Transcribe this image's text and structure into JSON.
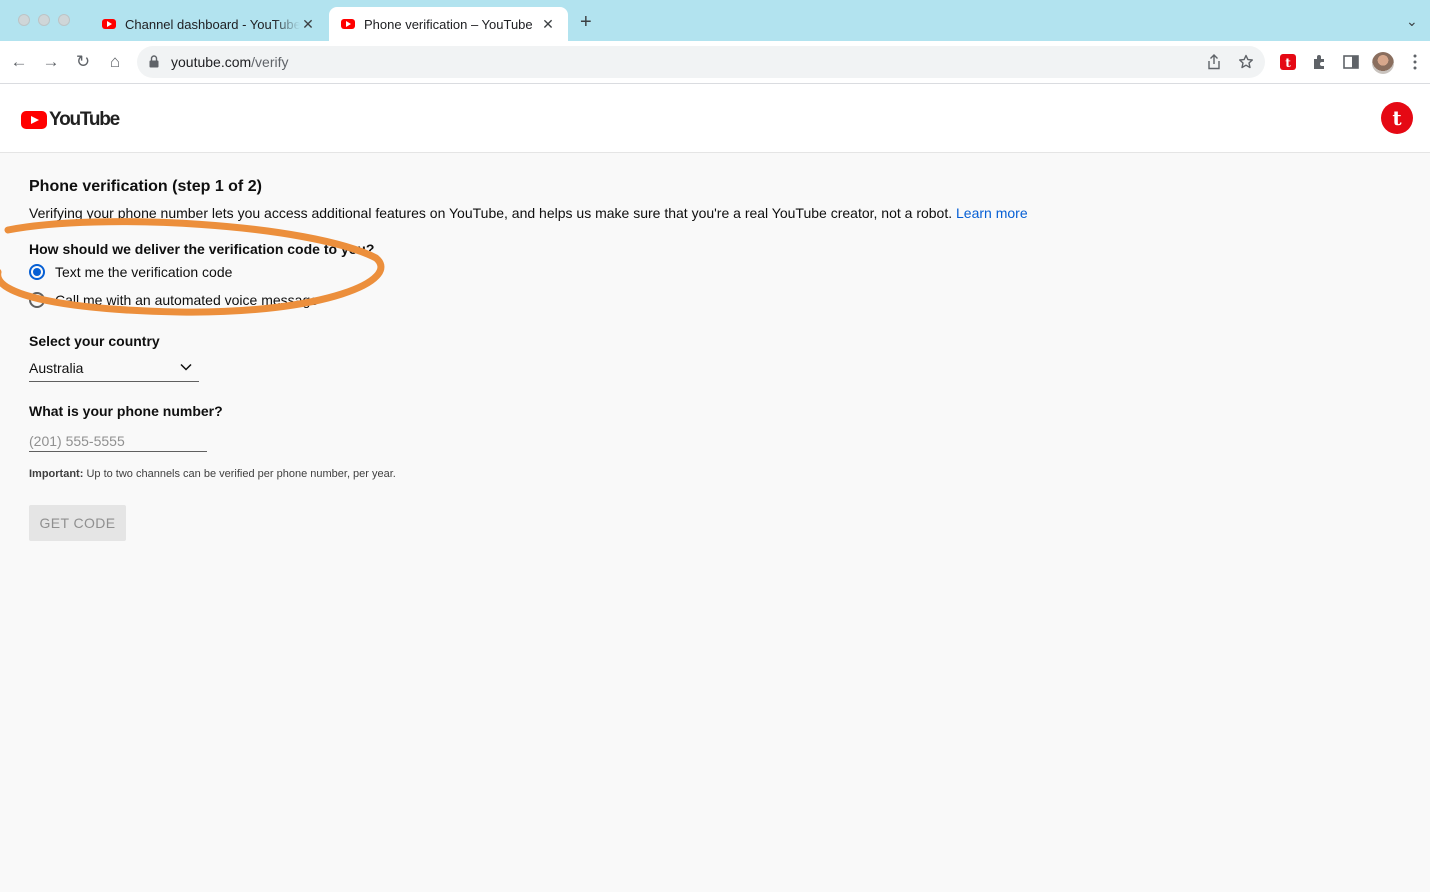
{
  "browser": {
    "tabs": [
      {
        "title": "Channel dashboard - YouTube Studio",
        "active": false
      },
      {
        "title": "Phone verification – YouTube",
        "active": true
      }
    ],
    "new_tab_symbol": "+",
    "tab_menu_symbol": "⌄",
    "close_symbol": "✕",
    "url_host": "youtube.com",
    "url_path": "/verify",
    "nav": {
      "back": "←",
      "forward": "→",
      "reload": "↻",
      "home": "⌂"
    },
    "icons": [
      "share-icon",
      "bookmark-star-icon",
      "extension-t-icon",
      "puzzle-icon",
      "side-panel-icon",
      "profile-avatar",
      "kebab-menu-icon"
    ]
  },
  "header": {
    "logo_text": "YouTube",
    "channel_avatar_letter": "t"
  },
  "verify": {
    "title": "Phone verification (step 1 of 2)",
    "intro": "Verifying your phone number lets you access additional features on YouTube, and helps us make sure that you're a real YouTube creator, not a robot.",
    "learn_more": "Learn more",
    "delivery_question": "How should we deliver the verification code to you?",
    "options": [
      {
        "label": "Text me the verification code",
        "checked": true
      },
      {
        "label": "Call me with an automated voice message",
        "checked": false
      }
    ],
    "country_label": "Select your country",
    "country_value": "Australia",
    "phone_label": "What is your phone number?",
    "phone_placeholder": "(201) 555-5555",
    "note_bold": "Important:",
    "note_text": " Up to two channels can be verified per phone number, per year.",
    "get_code_label": "GET CODE"
  },
  "colors": {
    "tab_bar": "#b2e3ef",
    "youtube_red": "#ff0000",
    "link_blue": "#065fd4",
    "annotation_orange": "#ec8f3c"
  }
}
